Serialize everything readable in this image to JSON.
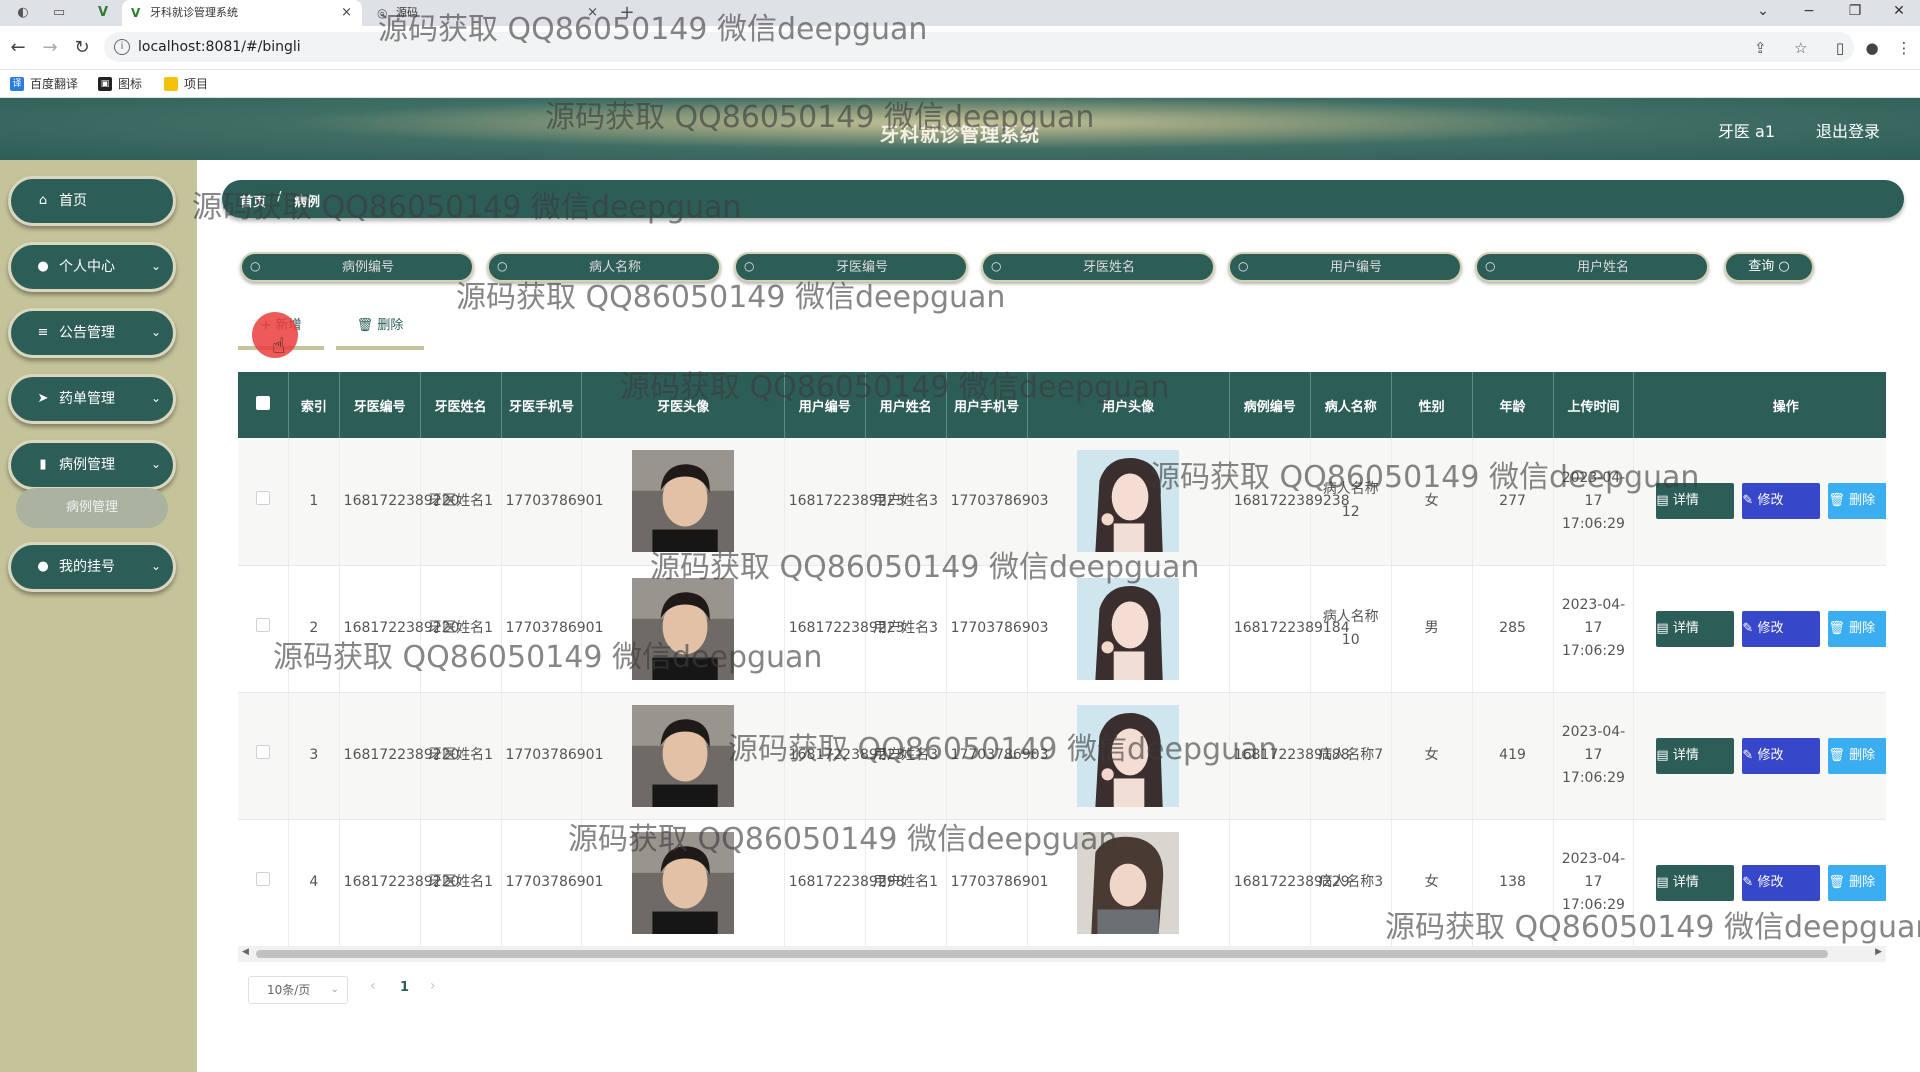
{
  "browser": {
    "tab_active_title": "牙科就诊管理系统",
    "tab_second_title": "源码",
    "url": "localhost:8081/#/bingli",
    "bookmarks": [
      "百度翻译",
      "图标",
      "项目"
    ]
  },
  "header": {
    "title": "牙科就诊管理系统",
    "user": "牙医 a1",
    "logout": "退出登录"
  },
  "sidebar": {
    "items": [
      {
        "label": "首页",
        "icon": "home-icon"
      },
      {
        "label": "个人中心",
        "icon": "user-icon"
      },
      {
        "label": "公告管理",
        "icon": "list-icon"
      },
      {
        "label": "药单管理",
        "icon": "send-icon"
      },
      {
        "label": "病例管理",
        "icon": "chart-icon"
      },
      {
        "label": "我的挂号",
        "icon": "pin-icon"
      }
    ],
    "sub_item": "病例管理"
  },
  "breadcrumb": {
    "home": "首页",
    "separator": "/",
    "current": "病例"
  },
  "search": {
    "placeholders": [
      "病例编号",
      "病人名称",
      "牙医编号",
      "牙医姓名",
      "用户编号",
      "用户姓名"
    ],
    "query_label": "查询"
  },
  "actions": {
    "add_label": "+ 新增",
    "delete_label": "删除"
  },
  "table": {
    "headers": [
      "索引",
      "牙医编号",
      "牙医姓名",
      "牙医手机号",
      "牙医头像",
      "用户编号",
      "用户姓名",
      "用户手机号",
      "用户头像",
      "病例编号",
      "病人名称",
      "性别",
      "年龄",
      "上传时间",
      "操作"
    ],
    "rows": [
      {
        "index": "1",
        "dentist_id": "1681722389220",
        "dentist_name": "牙医姓名1",
        "dentist_phone": "17703786901",
        "user_id": "1681722389223",
        "user_name": "用户姓名3",
        "user_phone": "17703786903",
        "case_id": "1681722389238",
        "patient": "病人名称12",
        "gender": "女",
        "age": "277",
        "time": "2023-04-17 17:06:29"
      },
      {
        "index": "2",
        "dentist_id": "1681722389220",
        "dentist_name": "牙医姓名1",
        "dentist_phone": "17703786901",
        "user_id": "1681722389223",
        "user_name": "用户姓名3",
        "user_phone": "17703786903",
        "case_id": "1681722389184",
        "patient": "病人名称10",
        "gender": "男",
        "age": "285",
        "time": "2023-04-17 17:06:29"
      },
      {
        "index": "3",
        "dentist_id": "1681722389220",
        "dentist_name": "牙医姓名1",
        "dentist_phone": "17703786901",
        "user_id": "1681722389223",
        "user_name": "用户姓名3",
        "user_phone": "17703786903",
        "case_id": "1681722389188",
        "patient": "病人名称7",
        "gender": "女",
        "age": "419",
        "time": "2023-04-17 17:06:29"
      },
      {
        "index": "4",
        "dentist_id": "1681722389220",
        "dentist_name": "牙医姓名1",
        "dentist_phone": "17703786901",
        "user_id": "1681722389298",
        "user_name": "用户姓名1",
        "user_phone": "17703786901",
        "case_id": "1681722389229",
        "patient": "病人名称3",
        "gender": "女",
        "age": "138",
        "time": "2023-04-17 17:06:29"
      }
    ],
    "op_detail": "详情",
    "op_edit": "修改",
    "op_delete": "删除"
  },
  "pagination": {
    "page_size": "10条/页",
    "current_page": "1"
  },
  "watermark": "源码获取 QQ86050149 微信deepguan",
  "colors": {
    "primary": "#2d5d57",
    "sidebar_bg": "#c5c39a",
    "edit": "#3747c9",
    "delete": "#3aaef0"
  }
}
